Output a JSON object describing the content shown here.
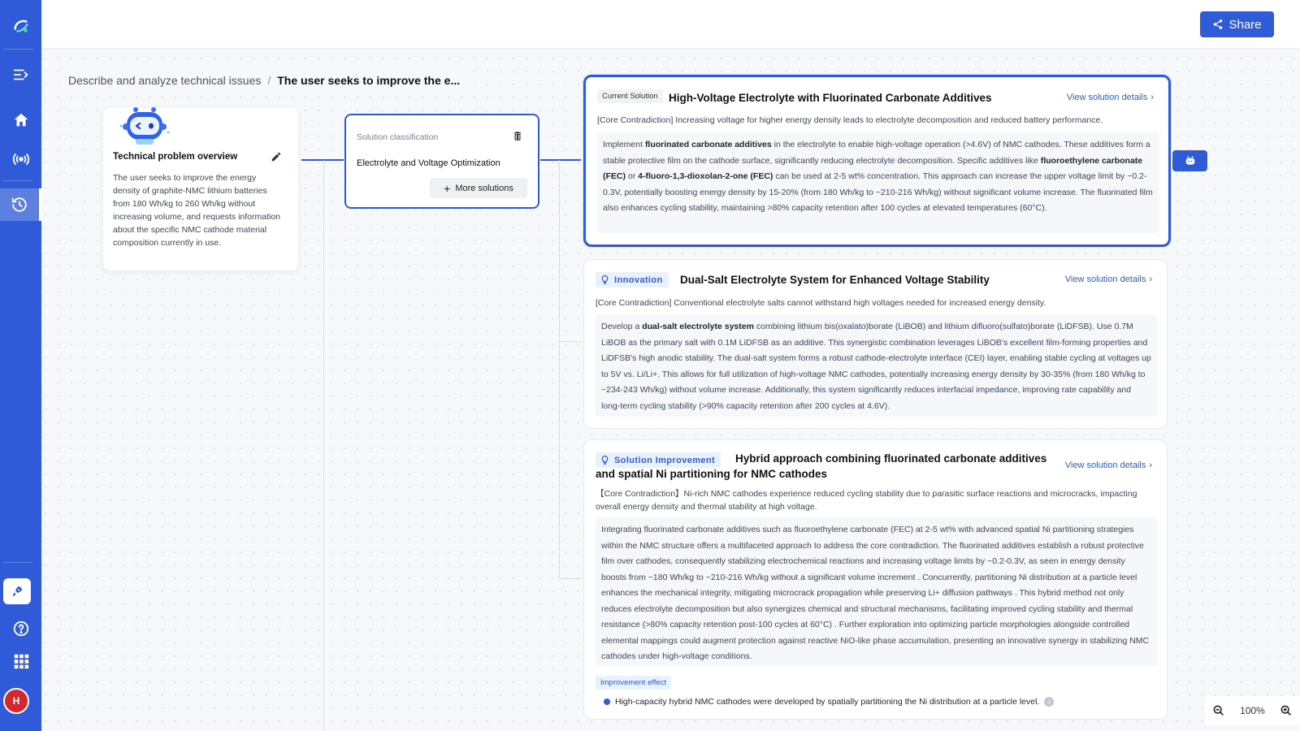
{
  "app": {
    "avatar_initial": "H"
  },
  "toolbar": {
    "share_label": "Share"
  },
  "breadcrumb": {
    "parent": "Describe and analyze technical issues",
    "separator": "/",
    "current": "The user seeks to improve the e..."
  },
  "overview": {
    "title": "Technical problem overview",
    "text": "The user seeks to improve the energy density of graphite-NMC lithium batteries from 180 Wh/kg to 260 Wh/kg without increasing volume, and requests information about the specific NMC cathode material composition currently in use."
  },
  "classification": {
    "label": "Solution classification",
    "value": "Electrolyte and Voltage Optimization",
    "more_label": "More solutions"
  },
  "solutions": [
    {
      "tag": "Current Solution",
      "title": "High-Voltage Electrolyte with Fluorinated Carbonate Additives",
      "link": "View solution details",
      "core": "[Core Contradiction] Increasing voltage for higher energy density leads to electrolyte decomposition and reduced battery performance.",
      "body": [
        {
          "t": "Implement "
        },
        {
          "b": "fluorinated carbonate additives"
        },
        {
          "t": " in the electrolyte to enable high-voltage operation (>4.6V) of NMC cathodes. These additives form a stable protective film on the cathode surface, significantly reducing electrolyte decomposition. Specific additives like "
        },
        {
          "b": "fluoroethylene carbonate (FEC)"
        },
        {
          "t": " or "
        },
        {
          "b": "4-fluoro-1,3-dioxolan-2-one (FEC)"
        },
        {
          "t": " can be used at 2-5 wt% concentration. This approach can increase the upper voltage limit by ~0.2-0.3V, potentially boosting energy density by 15-20% (from 180 Wh/kg to ~210-216 Wh/kg) without significant volume increase. The fluorinated film also enhances cycling stability, maintaining >80% capacity retention after 100 cycles at elevated temperatures (60°C)."
        }
      ]
    },
    {
      "badge": "Innovation",
      "title": "Dual-Salt Electrolyte System for Enhanced Voltage Stability",
      "link": "View solution details",
      "core": "[Core Contradiction] Conventional electrolyte salts cannot withstand high voltages needed for increased energy density.",
      "body": [
        {
          "t": "Develop a "
        },
        {
          "b": "dual-salt electrolyte system"
        },
        {
          "t": " combining lithium bis(oxalato)borate (LiBOB) and lithium difluoro(sulfato)borate (LiDFSB). Use 0.7M LiBOB as the primary salt with 0.1M LiDFSB as an additive. This synergistic combination leverages LiBOB's excellent film-forming properties and LiDFSB's high anodic stability. The dual-salt system forms a robust cathode-electrolyte interface (CEI) layer, enabling stable cycling at voltages up to 5V vs. Li/Li+. This allows for full utilization of high-voltage NMC cathodes, potentially increasing energy density by 30-35% (from 180 Wh/kg to ~234-243 Wh/kg) without volume increase. Additionally, this system significantly reduces interfacial impedance, improving rate capability and long-term cycling stability (>90% capacity retention after 200 cycles at 4.6V)."
        }
      ]
    },
    {
      "badge": "Solution Improvement",
      "title": "Hybrid approach combining fluorinated carbonate additives and spatial Ni partitioning for NMC cathodes",
      "link": "View solution details",
      "core": "【Core Contradiction】Ni-rich NMC cathodes experience reduced cycling stability due to parasitic surface reactions and microcracks, impacting overall energy density and thermal stability at high voltage.",
      "body": [
        {
          "t": "Integrating fluorinated carbonate additives such as fluoroethylene carbonate (FEC) at 2-5 wt% with advanced spatial Ni partitioning strategies within the NMC structure offers a multifaceted approach to address the core contradiction. The fluorinated additives establish a robust protective film over cathodes, consequently stabilizing electrochemical reactions and increasing voltage limits by ~0.2-0.3V, as seen in energy density boosts from ~180 Wh/kg to ~210-216 Wh/kg without a significant volume increment . Concurrently, partitioning Ni distribution at a particle level enhances the mechanical integrity, mitigating microcrack propagation while preserving Li+ diffusion pathways . This hybrid method not only reduces electrolyte decomposition but also synergizes chemical and structural mechanisms, facilitating improved cycling stability and thermal resistance (>80% capacity retention post-100 cycles at 60°C) . Further exploration into optimizing particle morphologies alongside controlled elemental mappings could augment protection against reactive NiO-like phase accumulation, presenting an innovative synergy in stabilizing NMC cathodes under high-voltage conditions."
        }
      ],
      "effect_label": "Improvement effect",
      "effect_text": "High-capacity hybrid NMC cathodes were developed by spatially partitioning the Ni distribution at a particle level."
    }
  ],
  "zoom": {
    "level": "100%"
  }
}
